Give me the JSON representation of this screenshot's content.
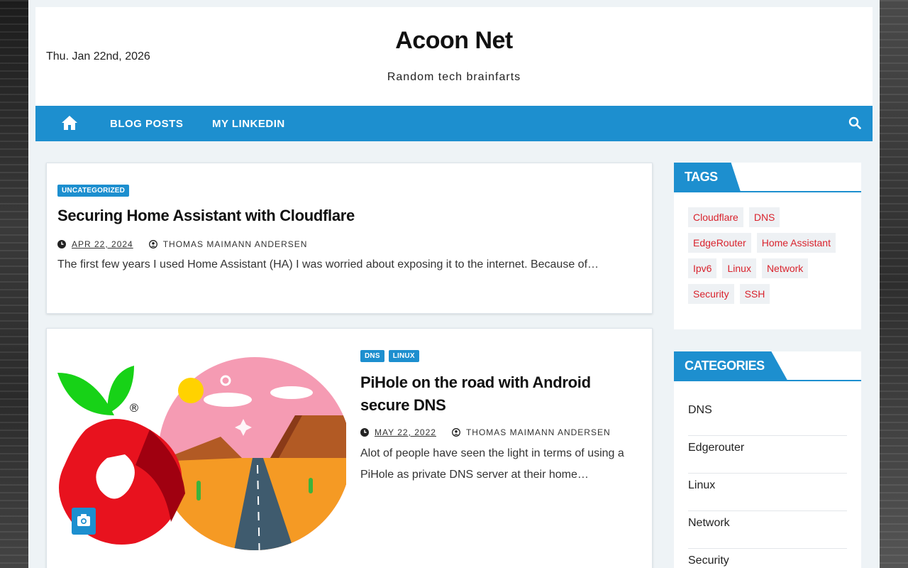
{
  "header": {
    "date": "Thu. Jan 22nd, 2026",
    "site_title": "Acoon Net",
    "tagline": "Random tech brainfarts"
  },
  "nav": {
    "home_icon": "home-icon",
    "items": [
      {
        "label": "BLOG POSTS"
      },
      {
        "label": "MY LINKEDIN"
      }
    ],
    "search_icon": "search-icon"
  },
  "posts": [
    {
      "categories": [
        "UNCATEGORIZED"
      ],
      "title": "Securing Home Assistant with Cloudflare",
      "date": "APR 22, 2024",
      "author": "THOMAS MAIMANN ANDERSEN",
      "excerpt": "The first few years I used Home Assistant (HA) I was worried about exposing it to the internet. Because of…"
    },
    {
      "categories": [
        "DNS",
        "LINUX"
      ],
      "title": "PiHole on the road with Android secure DNS",
      "date": "MAY 22, 2022",
      "author": "THOMAS MAIMANN ANDERSEN",
      "excerpt": "Alot of people have seen the light in terms of using a PiHole as private DNS server at their home…",
      "image_icon": "camera-icon"
    }
  ],
  "sidebar": {
    "tags_title": "TAGS",
    "tags": [
      "Cloudflare",
      "DNS",
      "EdgeRouter",
      "Home Assistant",
      "Ipv6",
      "Linux",
      "Network",
      "Security",
      "SSH"
    ],
    "categories_title": "CATEGORIES",
    "categories": [
      "DNS",
      "Edgerouter",
      "Linux",
      "Network",
      "Security"
    ]
  },
  "colors": {
    "accent": "#1d8fcf",
    "tag_text": "#d9232d",
    "page_bg": "#eef3f6"
  }
}
